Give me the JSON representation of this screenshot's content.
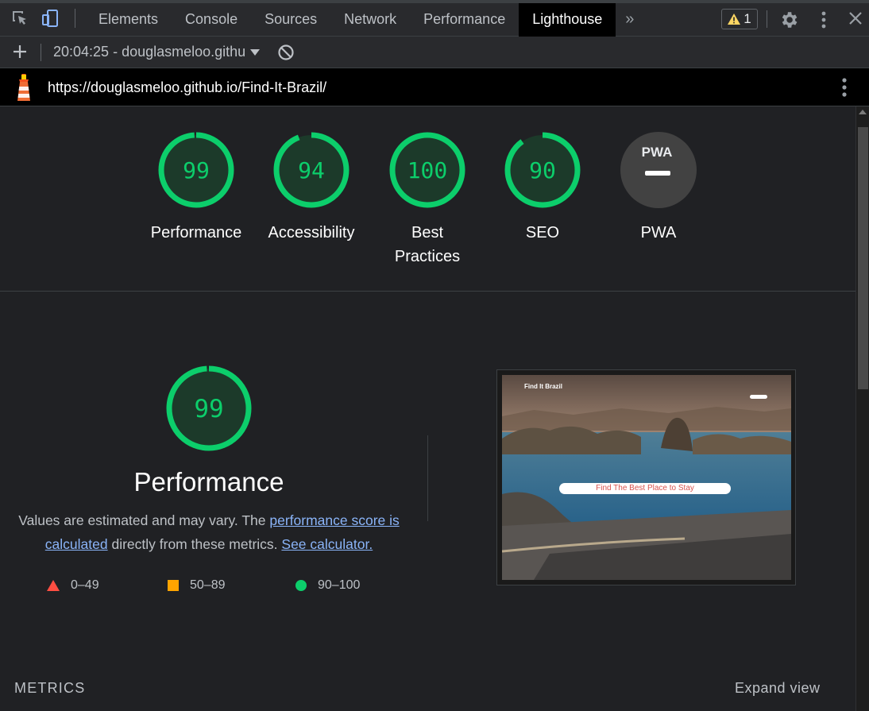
{
  "devtools": {
    "tabs": [
      "Elements",
      "Console",
      "Sources",
      "Network",
      "Performance",
      "Lighthouse"
    ],
    "active_tab": "Lighthouse",
    "warning_count": "1"
  },
  "toolbar": {
    "report_selector": "20:04:25 - douglasmeloo.githu"
  },
  "report": {
    "url": "https://douglasmeloo.github.io/Find-It-Brazil/",
    "gauges": [
      {
        "label": "Performance",
        "score": "99",
        "fraction": 0.99
      },
      {
        "label": "Accessibility",
        "score": "94",
        "fraction": 0.94
      },
      {
        "label": "Best Practices",
        "score": "100",
        "fraction": 1.0
      },
      {
        "label": "SEO",
        "score": "90",
        "fraction": 0.9
      },
      {
        "label": "PWA",
        "badge": "PWA"
      }
    ],
    "performance": {
      "score": "99",
      "fraction": 0.99,
      "title": "Performance",
      "desc_prefix": "Values are estimated and may vary. The ",
      "score_link": "performance score is calculated",
      "desc_middle": " directly from these metrics. ",
      "calc_link": "See calculator."
    },
    "legend": [
      "0–49",
      "50–89",
      "90–100"
    ],
    "screenshot": {
      "site_name": "Find It Brazil",
      "cta": "Find The Best Place to Stay"
    },
    "metrics_label": "METRICS",
    "expand_view": "Expand view"
  },
  "colors": {
    "pass": "#0cce6b",
    "average": "#ffa400",
    "fail": "#ff4e42",
    "link": "#8ab4f8"
  }
}
